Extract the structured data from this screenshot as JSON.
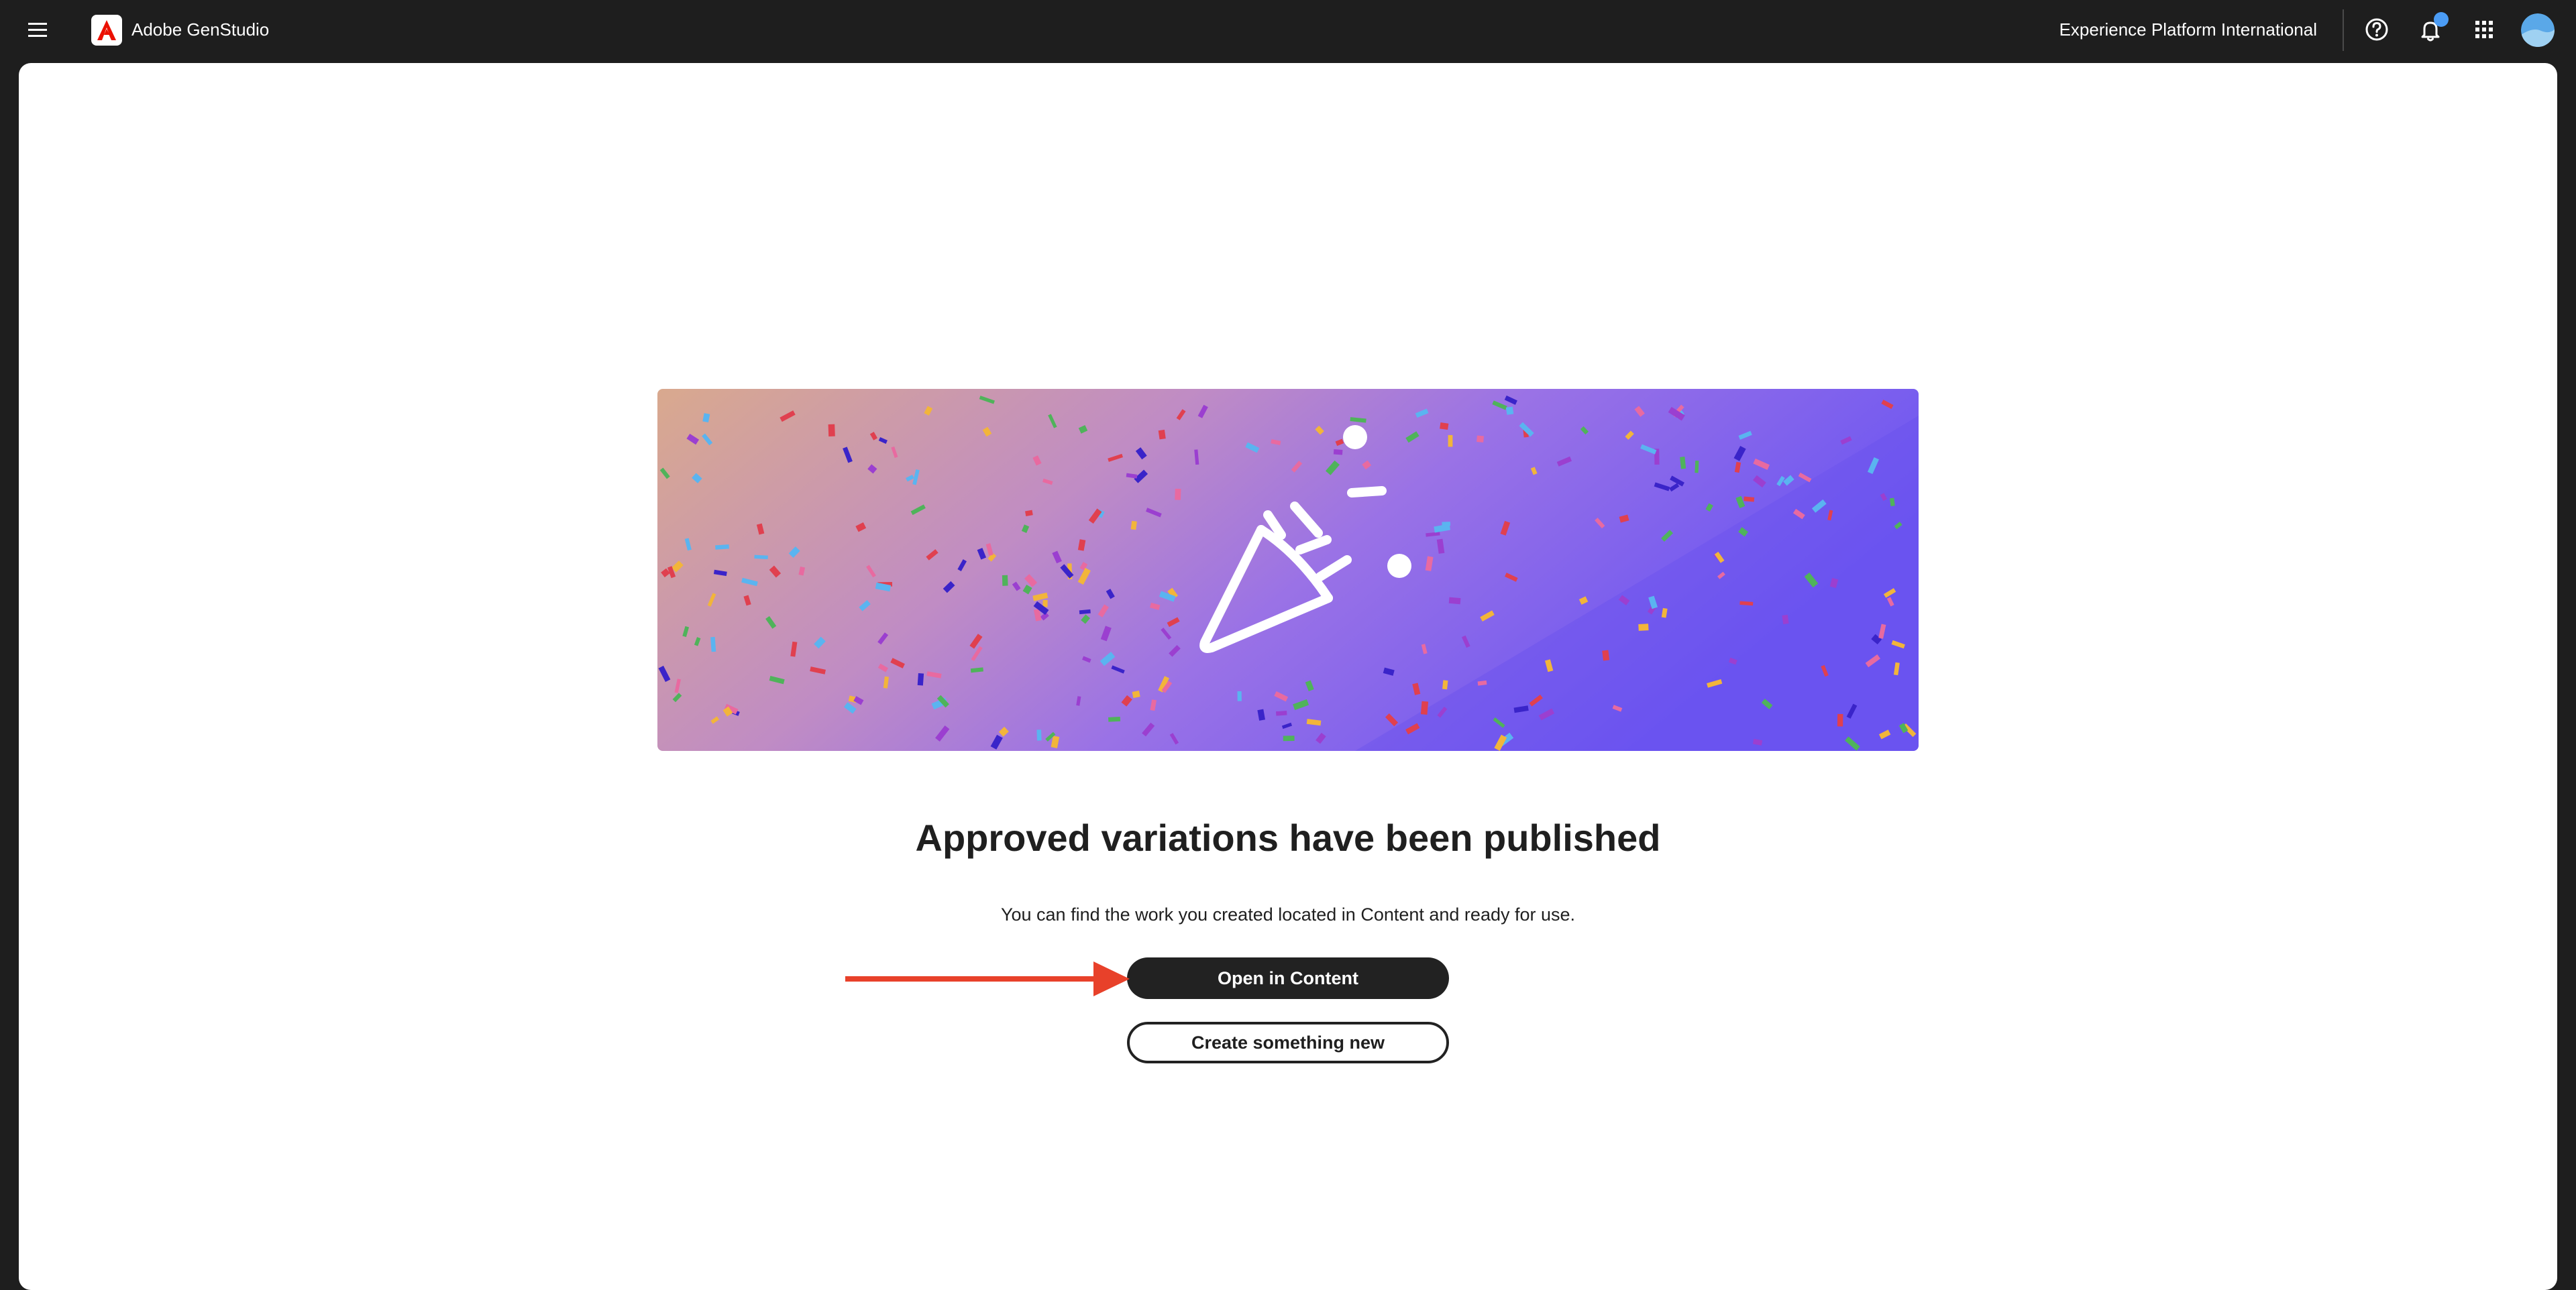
{
  "app": {
    "brand": "Adobe GenStudio",
    "organization": "Experience Platform International"
  },
  "icons": {
    "menu": "hamburger-menu-icon",
    "logo": "adobe-logo-icon",
    "help": "help-icon",
    "notifications": "bell-icon",
    "apps": "apps-grid-icon",
    "avatar": "user-avatar",
    "celebration": "party-popper-icon",
    "annotation": "red-arrow-icon"
  },
  "colors": {
    "topbar": "#1e1e1e",
    "accent_notification": "#4b9cf5",
    "brand_red": "#eb1000",
    "banner_gradient_start": "#d9a98e",
    "banner_gradient_mid": "#b18cd6",
    "banner_gradient_end": "#6b55f2",
    "annotation_arrow": "#e8412a"
  },
  "main": {
    "headline": "Approved variations have been published",
    "description": "You can find the work you created located in Content and ready for use.",
    "primary_button": "Open in Content",
    "secondary_button": "Create something new"
  }
}
